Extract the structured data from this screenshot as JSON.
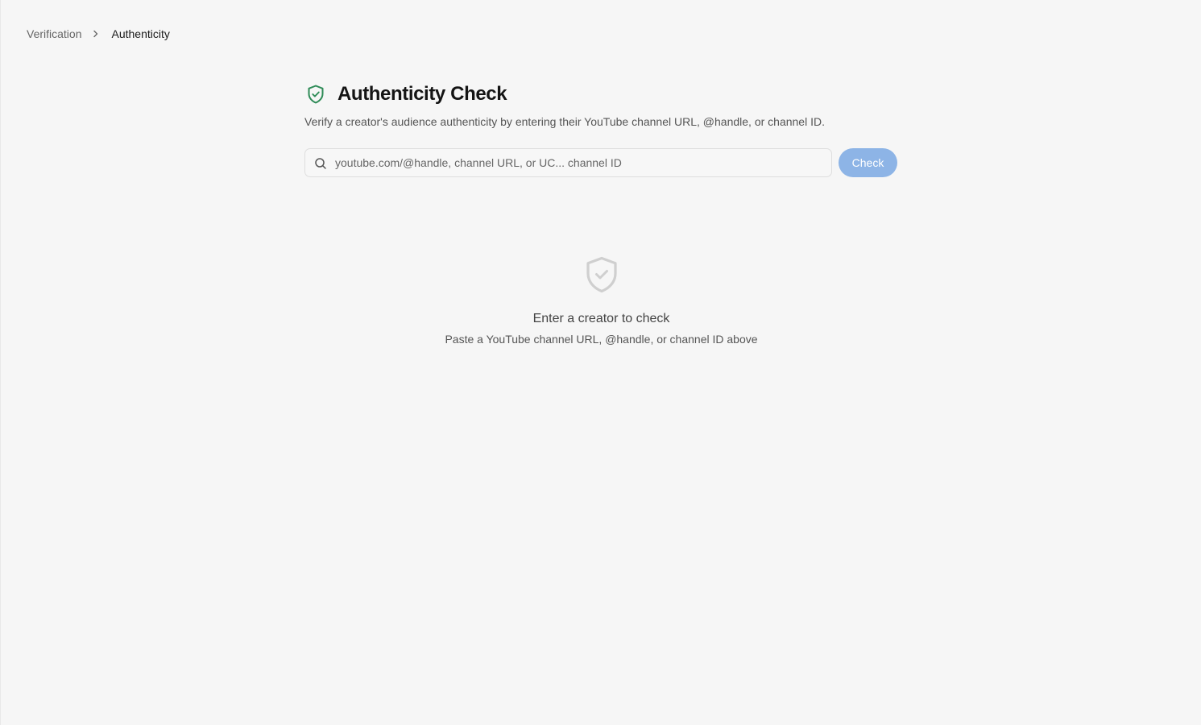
{
  "breadcrumb": {
    "parent": "Verification",
    "current": "Authenticity",
    "separator_icon": "chevron-right-icon"
  },
  "header": {
    "title": "Authenticity Check",
    "subtitle": "Verify a creator's audience authenticity by entering their YouTube channel URL, @handle, or channel ID.",
    "icon": "shield-check-icon",
    "icon_color": "#2e8b57"
  },
  "search": {
    "value": "",
    "placeholder": "youtube.com/@handle, channel URL, or UC... channel ID",
    "icon": "search-icon"
  },
  "actions": {
    "check_label": "Check",
    "check_color": "#8db4e6"
  },
  "empty_state": {
    "icon": "shield-check-icon",
    "title": "Enter a creator to check",
    "description": "Paste a YouTube channel URL, @handle, or channel ID above"
  }
}
